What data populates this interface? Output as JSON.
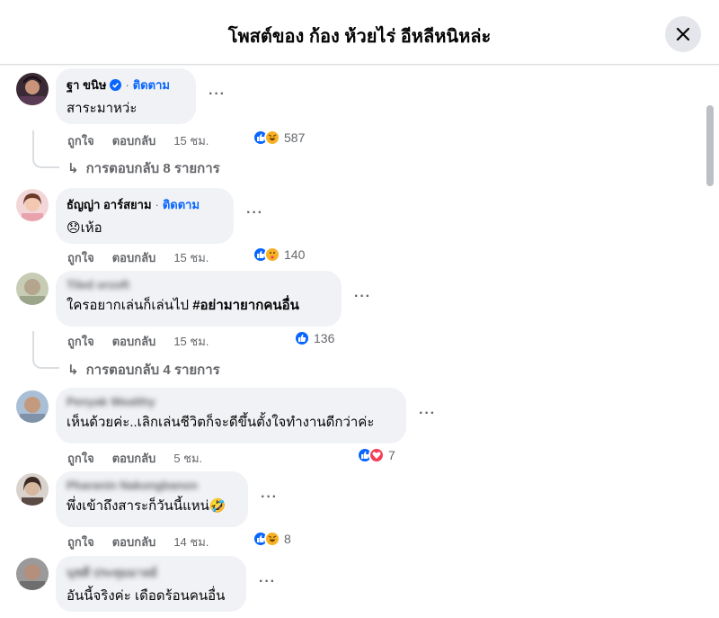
{
  "header": {
    "title": "โพสต์ของ ก้อง ห้วยไร่ อีหลีหนิหล่ะ",
    "close_icon": "close-icon"
  },
  "actions": {
    "like": "ถูกใจ",
    "reply": "ตอบกลับ"
  },
  "comments": [
    {
      "name": "ฐา ขนิษ",
      "verified": true,
      "follow": "ติดตาม",
      "text": "สาระมาหว่ะ",
      "time": "15 ชม.",
      "reactions": [
        "like",
        "haha"
      ],
      "count": "587",
      "replies": "การตอบกลับ 8 รายการ"
    },
    {
      "name": "ธัญญ่า อาร์สยาม",
      "verified": false,
      "follow": "ติดตาม",
      "text_emoji": "😞",
      "text": "เห้อ",
      "time": "15 ชม.",
      "reactions": [
        "like",
        "care"
      ],
      "count": "140"
    },
    {
      "name": "Tiled orzoft",
      "text": "ใครอยากเล่นก็เล่นไป ",
      "hashtag": "#อย่ามายากคนอื่น",
      "time": "15 ชม.",
      "reactions": [
        "like"
      ],
      "count": "136",
      "replies": "การตอบกลับ 4 รายการ"
    },
    {
      "name": "Penyak Wealthy",
      "text": "เห็นด้วยค่ะ..เลิกเล่นชีวิตก็จะดีขึ้นตั้งใจทำงานดีกว่าค่ะ",
      "time": "5 ชม.",
      "reactions": [
        "like",
        "love"
      ],
      "count": "7"
    },
    {
      "name": "Pharanin Nakongbanon",
      "text": "พึ่งเข้าถึงสาระก็วันนี้แหน่🤣",
      "time": "14 ชม.",
      "reactions": [
        "like",
        "haha"
      ],
      "count": "8"
    },
    {
      "name": "นุชดี ประทุมมาลย์",
      "text": "อันนี้จริงค่ะ เดือดร้อนคนอื่น"
    }
  ],
  "colors": {
    "blue": "#0866ff",
    "bubble": "#f0f2f5",
    "meta": "#65676b",
    "love": "#f33e58",
    "haha": "#f7b125"
  }
}
